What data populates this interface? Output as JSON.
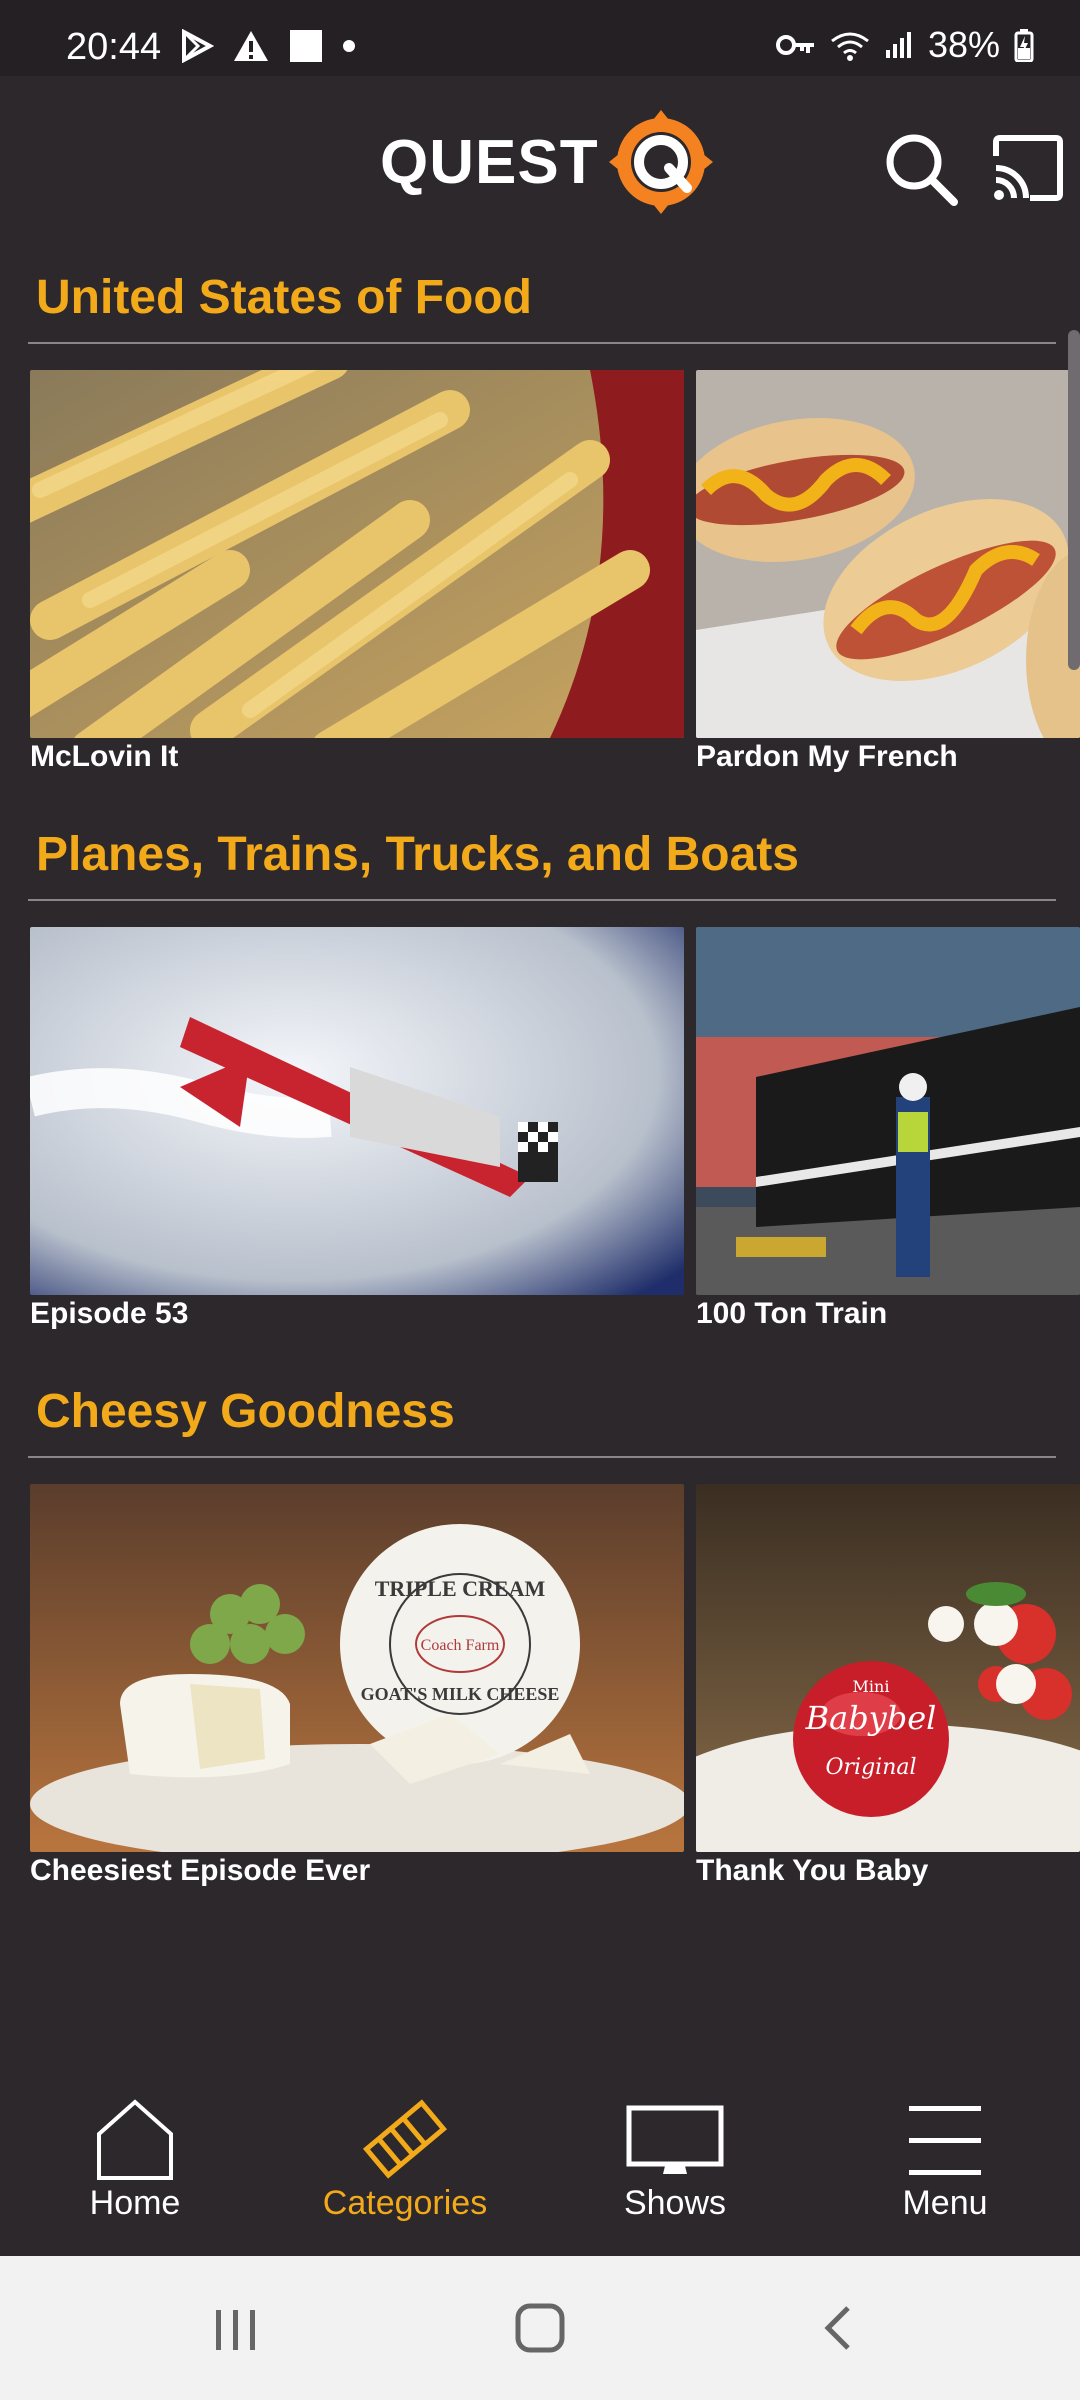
{
  "status_bar": {
    "time": "20:44",
    "battery": "38%"
  },
  "app": {
    "logo_text": "QUEST"
  },
  "sections": [
    {
      "title": "United States of Food",
      "items": [
        {
          "caption": "McLovin It",
          "image": "french fries"
        },
        {
          "caption": "Pardon My French",
          "image": "hot dogs with mustard"
        }
      ]
    },
    {
      "title": "Planes, Trains, Trucks, and Boats",
      "items": [
        {
          "caption": "Episode 53",
          "image": "red stunt plane with smoke"
        },
        {
          "caption": "100 Ton Train",
          "image": "black locomotive with worker"
        }
      ]
    },
    {
      "title": "Cheesy Goodness",
      "items": [
        {
          "caption": "Cheesiest Episode Ever",
          "image": "triple cream goat cheese",
          "label_lines": [
            "TRIPLE CREAM",
            "Coach Farm",
            "GOAT'S MILK CHEESE"
          ]
        },
        {
          "caption": "Thank You Baby",
          "image": "babybel cheese",
          "label_lines": [
            "Mini",
            "Babybel",
            "Original"
          ]
        }
      ]
    }
  ],
  "bottom_nav": [
    {
      "label": "Home",
      "icon": "home-icon",
      "active": false
    },
    {
      "label": "Categories",
      "icon": "film-strip-icon",
      "active": true
    },
    {
      "label": "Shows",
      "icon": "tv-icon",
      "active": false
    },
    {
      "label": "Menu",
      "icon": "hamburger-menu-icon",
      "active": false
    }
  ],
  "colors": {
    "accent": "#f2a91a",
    "background": "#2d282b",
    "status_bar": "#242023",
    "system_nav": "#f2f2f2"
  }
}
